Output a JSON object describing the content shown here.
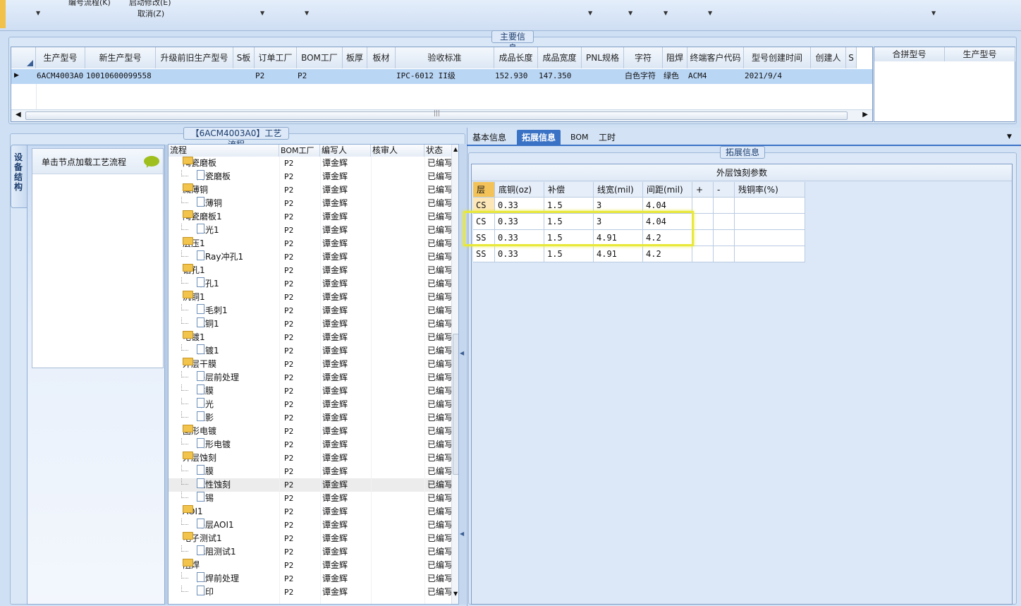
{
  "top_menu": {
    "line1_a": "编号流程(K)",
    "line1_b": "启动修改(E)",
    "cancel": "取消(Z)"
  },
  "main_info": {
    "legend": "主要信息",
    "columns": [
      "生产型号",
      "新生产型号",
      "升级前旧生产型号",
      "S板",
      "订单工厂",
      "BOM工厂",
      "板厚",
      "板材",
      "验收标准",
      "成品长度",
      "成品宽度",
      "PNL规格",
      "字符",
      "阻焊",
      "终端客户代码",
      "型号创建时间",
      "创建人",
      "S"
    ],
    "row": [
      "6ACM4003A0",
      "10010600099558",
      "",
      "",
      "P2",
      "P2",
      "",
      "",
      "IPC-6012 II级",
      "152.930",
      "147.350",
      "",
      "白色字符",
      "绿色",
      "ACM4",
      "2021/9/4",
      "",
      ""
    ],
    "side_columns": [
      "合拼型号",
      "生产型号"
    ]
  },
  "left_panel": {
    "vertical_tab": "设备结构",
    "load_label": "单击节点加载工艺流程"
  },
  "process": {
    "legend": "【6ACM4003A0】工艺流程",
    "columns": [
      "流程",
      "BOM工厂",
      "编写人",
      "核审人",
      "状态"
    ],
    "rows": [
      {
        "kind": "child",
        "name": "陶瓷磨板",
        "factory": "P2",
        "author": "谭金辉",
        "reviewer": "",
        "status": "已编写"
      },
      {
        "kind": "child",
        "name": "陶瓷磨板",
        "factory": "P2",
        "author": "谭金辉",
        "reviewer": "",
        "status": "已编写"
      },
      {
        "kind": "folder",
        "name": "减薄铜",
        "factory": "P2",
        "author": "谭金辉",
        "reviewer": "",
        "status": "已编写"
      },
      {
        "kind": "child",
        "name": "减薄铜",
        "factory": "P2",
        "author": "谭金辉",
        "reviewer": "",
        "status": "已编写"
      },
      {
        "kind": "folder",
        "name": "陶瓷磨板1",
        "factory": "P2",
        "author": "谭金辉",
        "reviewer": "",
        "status": "已编写"
      },
      {
        "kind": "child",
        "name": "抛光1",
        "factory": "P2",
        "author": "谭金辉",
        "reviewer": "",
        "status": "已编写"
      },
      {
        "kind": "folder",
        "name": "层压1",
        "factory": "P2",
        "author": "谭金辉",
        "reviewer": "",
        "status": "已编写"
      },
      {
        "kind": "child",
        "name": "X-Ray冲孔1",
        "factory": "P2",
        "author": "谭金辉",
        "reviewer": "",
        "status": "已编写"
      },
      {
        "kind": "folder",
        "name": "钻孔1",
        "factory": "P2",
        "author": "谭金辉",
        "reviewer": "",
        "status": "已编写"
      },
      {
        "kind": "child",
        "name": "钻孔1",
        "factory": "P2",
        "author": "谭金辉",
        "reviewer": "",
        "status": "已编写"
      },
      {
        "kind": "folder",
        "name": "沉铜1",
        "factory": "P2",
        "author": "谭金辉",
        "reviewer": "",
        "status": "已编写"
      },
      {
        "kind": "child",
        "name": "去毛刺1",
        "factory": "P2",
        "author": "谭金辉",
        "reviewer": "",
        "status": "已编写"
      },
      {
        "kind": "child",
        "name": "沉铜1",
        "factory": "P2",
        "author": "谭金辉",
        "reviewer": "",
        "status": "已编写"
      },
      {
        "kind": "folder",
        "name": "电镀1",
        "factory": "P2",
        "author": "谭金辉",
        "reviewer": "",
        "status": "已编写"
      },
      {
        "kind": "child",
        "name": "板镀1",
        "factory": "P2",
        "author": "谭金辉",
        "reviewer": "",
        "status": "已编写"
      },
      {
        "kind": "folder",
        "name": "外层干膜",
        "factory": "P2",
        "author": "谭金辉",
        "reviewer": "",
        "status": "已编写"
      },
      {
        "kind": "child",
        "name": "外层前处理",
        "factory": "P2",
        "author": "谭金辉",
        "reviewer": "",
        "status": "已编写"
      },
      {
        "kind": "child",
        "name": "贴膜",
        "factory": "P2",
        "author": "谭金辉",
        "reviewer": "",
        "status": "已编写"
      },
      {
        "kind": "child",
        "name": "曝光",
        "factory": "P2",
        "author": "谭金辉",
        "reviewer": "",
        "status": "已编写"
      },
      {
        "kind": "child",
        "name": "显影",
        "factory": "P2",
        "author": "谭金辉",
        "reviewer": "",
        "status": "已编写"
      },
      {
        "kind": "folder",
        "name": "图形电镀",
        "factory": "P2",
        "author": "谭金辉",
        "reviewer": "",
        "status": "已编写"
      },
      {
        "kind": "child",
        "name": "图形电镀",
        "factory": "P2",
        "author": "谭金辉",
        "reviewer": "",
        "status": "已编写"
      },
      {
        "kind": "folder",
        "name": "外层蚀刻",
        "factory": "P2",
        "author": "谭金辉",
        "reviewer": "",
        "status": "已编写"
      },
      {
        "kind": "child",
        "name": "退膜",
        "factory": "P2",
        "author": "谭金辉",
        "reviewer": "",
        "status": "已编写"
      },
      {
        "kind": "child",
        "name": "碱性蚀刻",
        "factory": "P2",
        "author": "谭金辉",
        "reviewer": "",
        "status": "已编写",
        "selected": true
      },
      {
        "kind": "child",
        "name": "退锡",
        "factory": "P2",
        "author": "谭金辉",
        "reviewer": "",
        "status": "已编写"
      },
      {
        "kind": "folder",
        "name": "AOI1",
        "factory": "P2",
        "author": "谭金辉",
        "reviewer": "",
        "status": "已编写"
      },
      {
        "kind": "child",
        "name": "外层AOI1",
        "factory": "P2",
        "author": "谭金辉",
        "reviewer": "",
        "status": "已编写"
      },
      {
        "kind": "folder",
        "name": "电子测试1",
        "factory": "P2",
        "author": "谭金辉",
        "reviewer": "",
        "status": "已编写"
      },
      {
        "kind": "child",
        "name": "低阻测试1",
        "factory": "P2",
        "author": "谭金辉",
        "reviewer": "",
        "status": "已编写"
      },
      {
        "kind": "folder",
        "name": "阻焊",
        "factory": "P2",
        "author": "谭金辉",
        "reviewer": "",
        "status": "已编写"
      },
      {
        "kind": "child",
        "name": "阻焊前处理",
        "factory": "P2",
        "author": "谭金辉",
        "reviewer": "",
        "status": "已编写"
      },
      {
        "kind": "child",
        "name": "丝印",
        "factory": "P2",
        "author": "谭金辉",
        "reviewer": "",
        "status": "已编写"
      }
    ],
    "first_folder_name": "陶瓷磨板"
  },
  "right": {
    "tabs": [
      "基本信息",
      "拓展信息",
      "BOM",
      "工时"
    ],
    "active_tab": 1,
    "legend": "拓展信息",
    "etch_title": "外层蚀刻参数",
    "etch_columns": [
      "层",
      "底铜(oz)",
      "补偿",
      "线宽(mil)",
      "间距(mil)",
      "+",
      "-",
      "残铜率(%)"
    ],
    "etch_rows": [
      [
        "CS",
        "0.33",
        "1.5",
        "3",
        "4.04",
        "",
        "",
        ""
      ],
      [
        "CS",
        "0.33",
        "1.5",
        "3",
        "4.04",
        "",
        "",
        ""
      ],
      [
        "SS",
        "0.33",
        "1.5",
        "4.91",
        "4.2",
        "",
        "",
        ""
      ],
      [
        "SS",
        "0.33",
        "1.5",
        "4.91",
        "4.2",
        "",
        "",
        ""
      ]
    ],
    "highlight_color": "#e8e83a"
  }
}
